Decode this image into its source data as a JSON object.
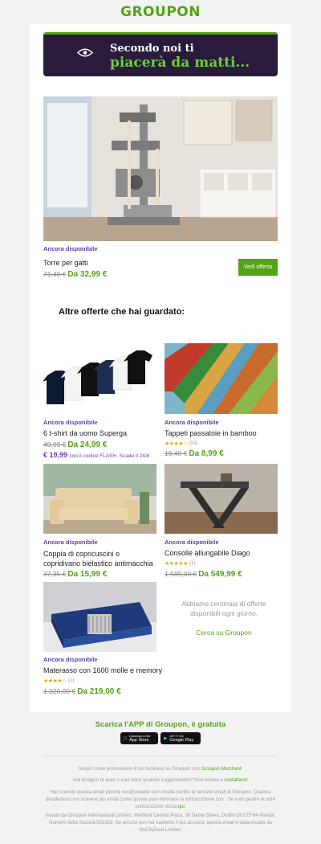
{
  "brand": {
    "logo": "GROUPON",
    "accent": "#53a318",
    "purple": "#5a3fa8"
  },
  "banner": {
    "line1": "Secondo noi ti",
    "line2": "piacerà da matti...",
    "icon": "eye-icon"
  },
  "hero": {
    "availability": "Ancora disponibile",
    "title": "Torre per gatti",
    "old_price": "71,40 €",
    "new_price": "Da 32,99 €",
    "button": "Vedi offerta"
  },
  "section_title": "Altre offerte che hai guardato:",
  "offers": [
    {
      "availability": "Ancora disponibile",
      "title": "6 t-shirt da uomo Superga",
      "old_price": "49,99 €",
      "new_price": "Da 24,99 €",
      "promo_price": "€ 19,99",
      "promo_text": "con il codice FLASH, Scade il 24/8"
    },
    {
      "availability": "Ancora disponibile",
      "title": "Tappeti passatoie in bamboo",
      "rating": 4,
      "reviews": "(53)",
      "old_price": "16,40 €",
      "new_price": "Da 8,99 €"
    },
    {
      "availability": "Ancora disponibile",
      "title": "Coppia di copricuscini o copridivano bielastico antimacchia",
      "old_price": "37,35 €",
      "new_price": "Da 15,99 €"
    },
    {
      "availability": "Ancora disponibile",
      "title": "Consolle allungabile Diago",
      "rating": 5,
      "reviews": "(1)",
      "old_price": "1.589,00 €",
      "new_price": "Da 549,99 €"
    },
    {
      "availability": "Ancora disponibile",
      "title": "Materasso con 1600 molle e memory",
      "rating": 4,
      "reviews": "(1)",
      "old_price": "1.320,00 €",
      "new_price": "Da 219,00 €"
    }
  ],
  "side": {
    "message": "Abbiamo centinaia di offerte disponibili ogni giorno.",
    "link": "Cerca su Groupon"
  },
  "footer": {
    "app_title": "Scarica l'APP di Groupon, è gratuita",
    "app_store_small": "Download on the",
    "app_store": "App Store",
    "google_small": "GET IT ON",
    "google": "Google Play",
    "merchant_text": "Scopri come promuovere il tuo business su Groupon con",
    "merchant_link": "Groupon Merchant.",
    "help_text": "Hai bisogno di aiuto o vuoi darci qualche suggerimento? Non esitare a",
    "help_link": "contattarci!",
    "info_text": "Hai ricevuto questa email perché xxx@ureader.com risulta iscritto al servizio email di Groupon. Qualora desiderassi non ricevere più email come questa puoi eliminare la sottoscrizione con . Se vuoi gestire le altre sottoscrizioni clicca",
    "info_link": "qui.",
    "legal": "Inviato da Groupon International Limited, WeWork Central Plaza, 36 Dame Street, Dublin D02 EF64 Irlanda, Numero della Società:501358. Se ancora non hai trasferito il tuo account, questa email è stata inviata da MyCityDeal Limited."
  }
}
